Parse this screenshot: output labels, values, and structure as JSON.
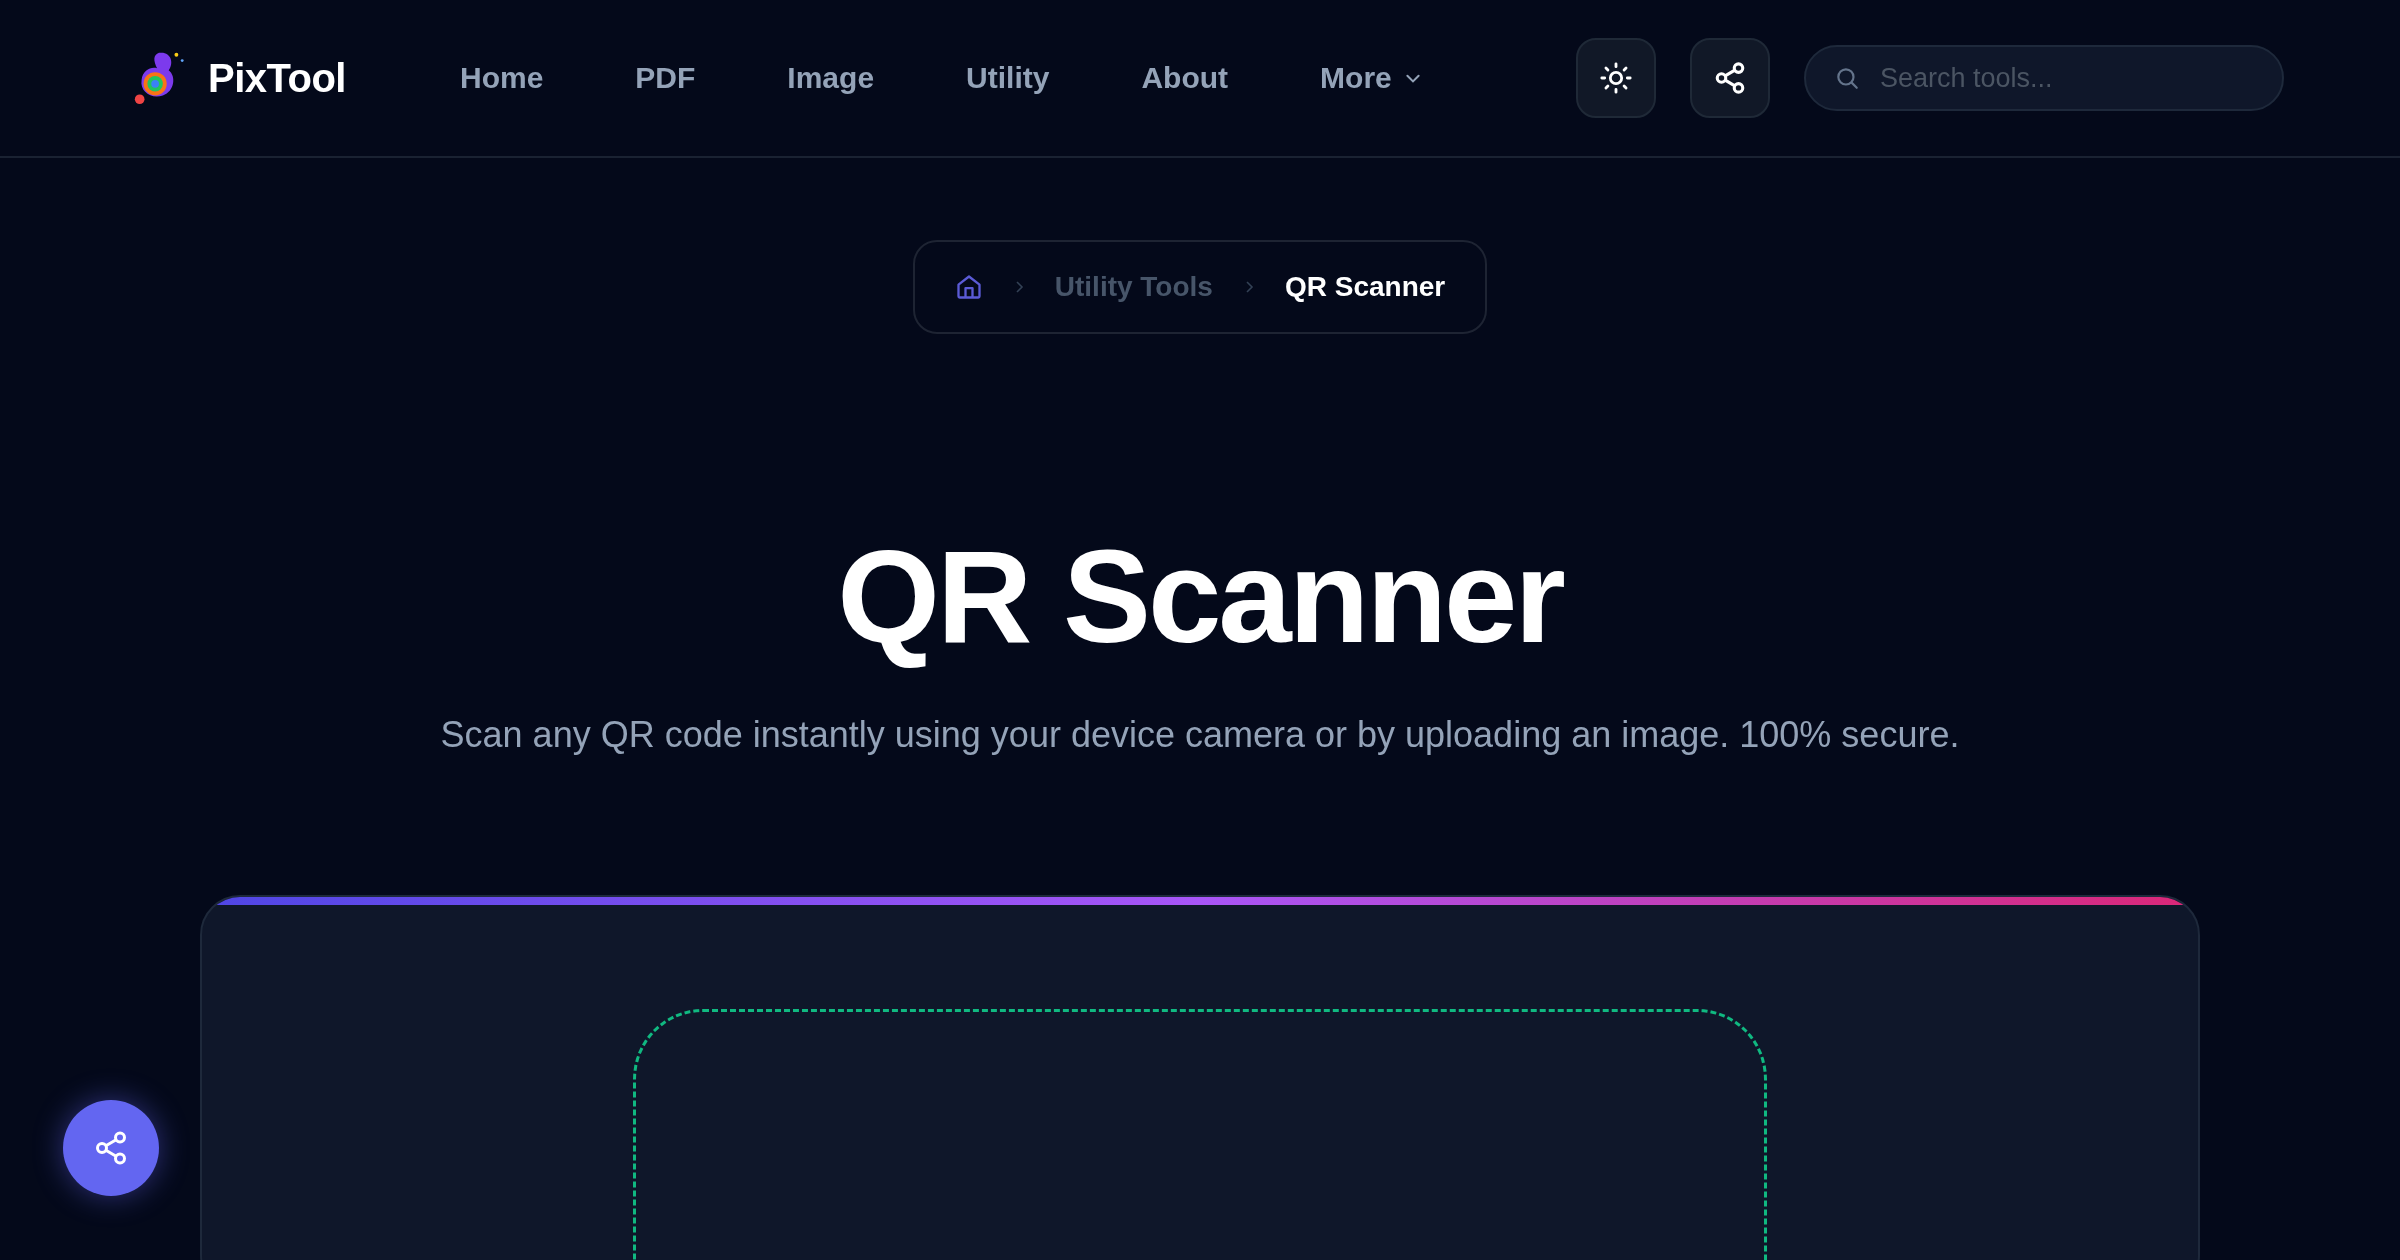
{
  "brand": {
    "name": "PixTool"
  },
  "nav": [
    {
      "label": "Home",
      "kind": "link"
    },
    {
      "label": "PDF",
      "kind": "link"
    },
    {
      "label": "Image",
      "kind": "link"
    },
    {
      "label": "Utility",
      "kind": "link"
    },
    {
      "label": "About",
      "kind": "link"
    },
    {
      "label": "More",
      "kind": "dropdown"
    }
  ],
  "search": {
    "placeholder": "Search tools..."
  },
  "breadcrumb": [
    {
      "label": "Utility Tools",
      "current": false
    },
    {
      "label": "QR Scanner",
      "current": true
    }
  ],
  "title": "QR Scanner",
  "subtitle": "Scan any QR code instantly using your device camera or by uploading an image. 100% secure."
}
